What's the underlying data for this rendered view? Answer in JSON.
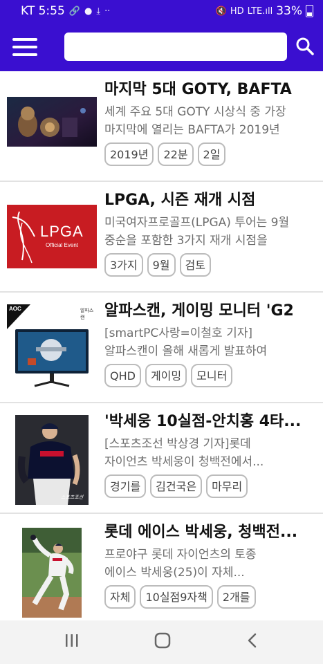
{
  "status_bar": {
    "carrier_time": "KT 5:55",
    "notification_icons": [
      "link-icon",
      "talk-icon",
      "download-off-icon",
      "more-dots-icon"
    ],
    "right_icons": [
      "mute-icon",
      "hd-icon",
      "lte-signal-icon"
    ],
    "network": "LTE",
    "battery": "33%"
  },
  "app_bar": {
    "menu_icon": "hamburger-menu-icon",
    "search_value": "",
    "search_icon": "search-icon",
    "color": "#3a0fd0"
  },
  "articles": [
    {
      "thumb_icon": "game-scene-thumbnail",
      "title": "마지막 5대 GOTY, BAFTA",
      "desc_lines": [
        "세계 주요 5대 GOTY 시상식 중 가장",
        "마지막에 열리는 BAFTA가 2019년"
      ],
      "tags": [
        "2019년",
        "22분",
        "2일"
      ]
    },
    {
      "thumb_icon": "lpga-logo-thumbnail",
      "thumb_text": "LPGA",
      "thumb_subtext": "Official Event",
      "title": "LPGA, 시즌 재개 시점",
      "desc_lines": [
        "미국여자프로골프(LPGA) 투어는 9월",
        "중순을 포함한 3가지 재개 시점을"
      ],
      "tags": [
        "3가지",
        "9월",
        "검토"
      ]
    },
    {
      "thumb_icon": "gaming-monitor-thumbnail",
      "thumb_text": "AOC",
      "thumb_subtext": "알파스캔",
      "title": "알파스캔, 게이밍 모니터 'G2",
      "desc_lines": [
        "[smartPC사랑=이철호 기자]",
        "알파스캔이 올해 새롭게 발표하여"
      ],
      "tags": [
        "QHD",
        "게이밍",
        "모니터"
      ]
    },
    {
      "thumb_icon": "baseball-player-thumbnail",
      "thumb_text": "스포츠조선",
      "title": "'박세웅 10실점-안치홍 4타...",
      "desc_lines": [
        "[스포츠조선 박상경 기자]롯데",
        "자이언츠 박세웅이 청백전에서..."
      ],
      "tags": [
        "경기를",
        "김건국은",
        "마무리"
      ]
    },
    {
      "thumb_icon": "pitcher-thumbnail",
      "title": "롯데 에이스 박세웅, 청백전...",
      "desc_lines": [
        "프로야구 롯데 자이언츠의 토종",
        "에이스 박세웅(25)이 자체..."
      ],
      "tags": [
        "자체",
        "10실점9자책",
        "2개를"
      ]
    }
  ],
  "nav_bar": {
    "recents_icon": "recents-icon",
    "home_icon": "home-icon",
    "back_icon": "back-icon"
  }
}
